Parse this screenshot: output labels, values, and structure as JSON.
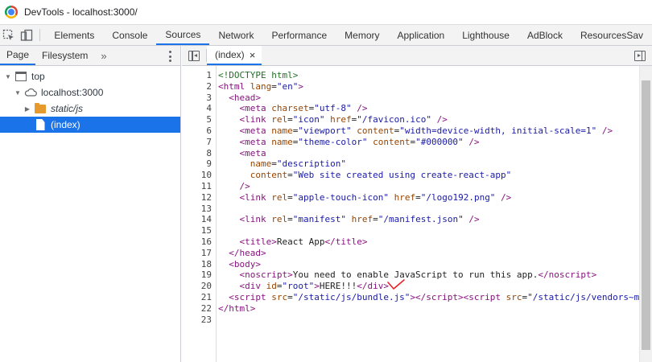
{
  "window": {
    "title": "DevTools - localhost:3000/"
  },
  "toolbar": {
    "tabs": [
      "Elements",
      "Console",
      "Sources",
      "Network",
      "Performance",
      "Memory",
      "Application",
      "Lighthouse",
      "AdBlock",
      "ResourcesSav"
    ],
    "active_tab": "Sources"
  },
  "navigator": {
    "tabs": [
      "Page",
      "Filesystem"
    ],
    "more_label": "»",
    "tree": {
      "top": "top",
      "origin": "localhost:3000",
      "folder": "static/js",
      "file": "(index)"
    }
  },
  "editor": {
    "file_tab": "(index)",
    "close_label": "×",
    "line_numbers": [
      "1",
      "2",
      "3",
      "4",
      "5",
      "6",
      "7",
      "8",
      "9",
      "10",
      "11",
      "12",
      "13",
      "14",
      "15",
      "16",
      "17",
      "18",
      "19",
      "20",
      "21",
      "22",
      "23"
    ]
  },
  "colors": {
    "accent": "#1a73e8",
    "tag": "#881280",
    "attr": "#994500",
    "value": "#1a1aa6",
    "comment": "#236e25",
    "annotation": "#e8232a"
  }
}
